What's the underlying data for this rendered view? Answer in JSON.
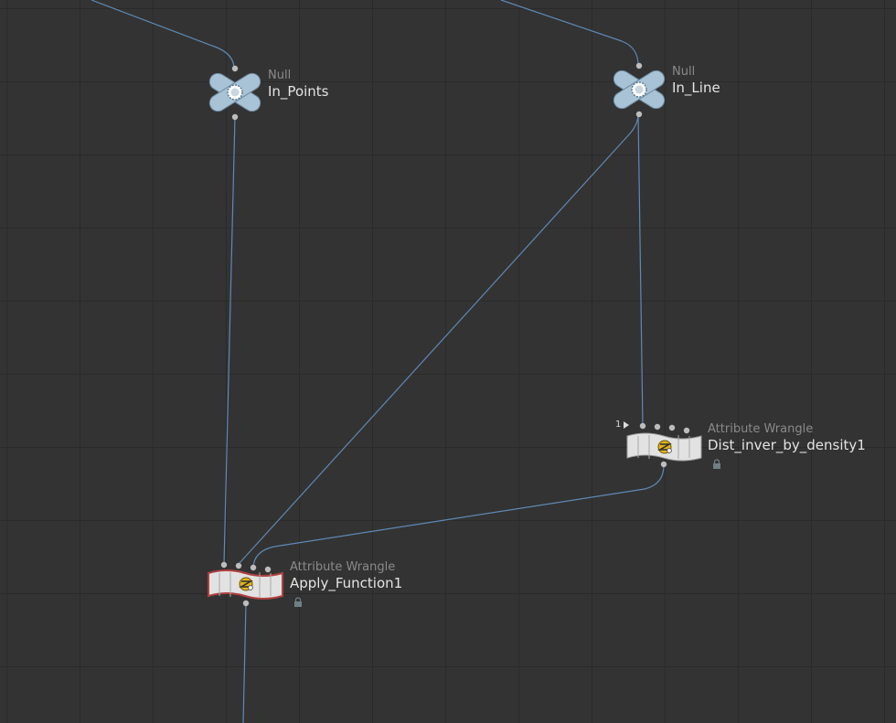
{
  "network": {
    "nodes": {
      "in_points": {
        "type": "Null",
        "name": "In_Points",
        "icon": "null-x-icon",
        "color": "#a9c3d6"
      },
      "in_line": {
        "type": "Null",
        "name": "In_Line",
        "icon": "null-x-icon",
        "color": "#a9c3d6"
      },
      "dist": {
        "type": "Attribute Wrangle",
        "name": "Dist_inver_by_density1",
        "icon": "wrangle-icon",
        "badge": "1",
        "locked": true
      },
      "apply": {
        "type": "Attribute Wrangle",
        "name": "Apply_Function1",
        "icon": "wrangle-icon",
        "locked": true,
        "selected_outline": "#b04040"
      }
    },
    "wire_color": "#5f89b4",
    "grid_color": "#2a2a2a",
    "background": "#333333"
  }
}
